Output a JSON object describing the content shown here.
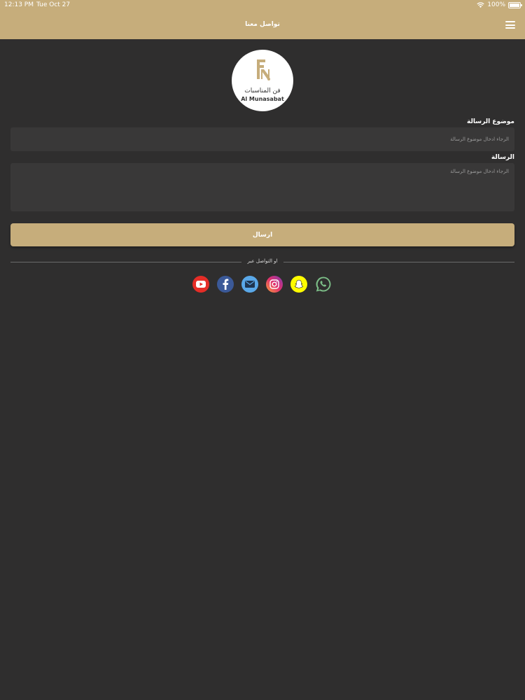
{
  "status_bar": {
    "time": "12:13 PM",
    "date": "Tue Oct 27",
    "battery": "100%"
  },
  "header": {
    "title": "تواصل معنا"
  },
  "logo": {
    "arabic": "فن المناسبات",
    "english": "Al Munasabat"
  },
  "form": {
    "subject_label": "موضوع الرسالة",
    "subject_placeholder": "الرجاء ادخال موضوع الرسالة",
    "message_label": "الرسالة",
    "message_placeholder": "الرجاء ادخال موضوع الرسالة",
    "send_label": "ارسال"
  },
  "divider_text": "او التواصل عبر",
  "social": [
    {
      "name": "youtube",
      "icon": "youtube-icon",
      "color": "#e52d27"
    },
    {
      "name": "facebook",
      "icon": "facebook-icon",
      "color": "#3b5998"
    },
    {
      "name": "email",
      "icon": "mail-icon",
      "color": "#5aa8e8"
    },
    {
      "name": "instagram",
      "icon": "instagram-icon",
      "color": "#c13584"
    },
    {
      "name": "snapchat",
      "icon": "snapchat-icon",
      "color": "#fffc00"
    },
    {
      "name": "whatsapp",
      "icon": "whatsapp-icon",
      "color": "#25d366"
    }
  ],
  "colors": {
    "accent": "#c6ad7b",
    "background": "#2f2e2e",
    "field": "#393838"
  }
}
